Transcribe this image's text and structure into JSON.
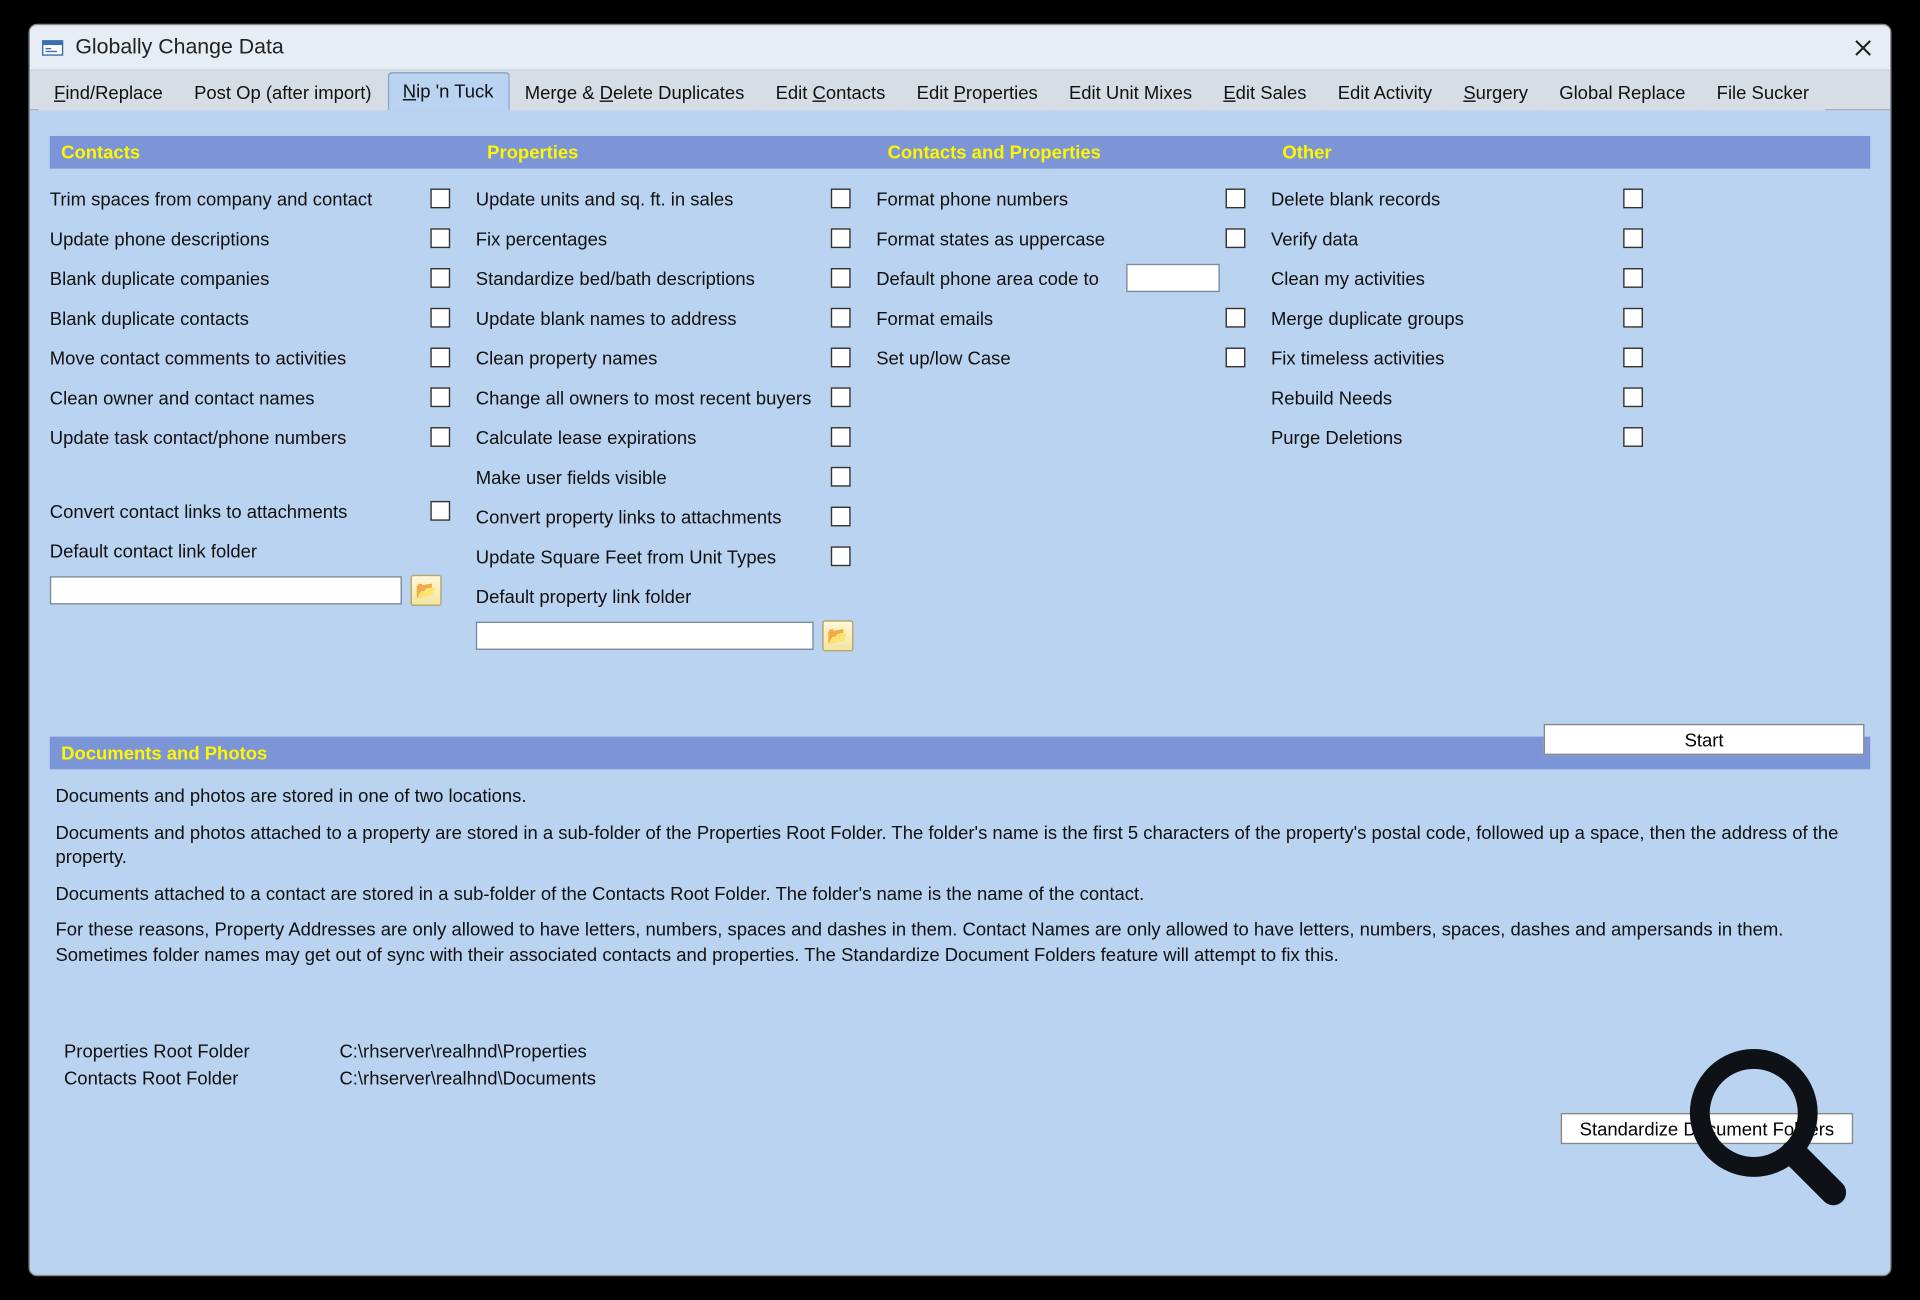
{
  "window": {
    "title": "Globally Change Data"
  },
  "tabs": [
    {
      "html": "<span class='ul'>F</span>ind/Replace"
    },
    {
      "html": "Post Op (after import)"
    },
    {
      "html": "<span class='ul'>N</span>ip 'n Tuck",
      "active": true
    },
    {
      "html": "Merge & <span class='ul'>D</span>elete Duplicates"
    },
    {
      "html": "Edit <span class='ul'>C</span>ontacts"
    },
    {
      "html": "Edit <span class='ul'>P</span>roperties"
    },
    {
      "html": "Edit Unit Mixes"
    },
    {
      "html": "<span class='ul'>E</span>dit Sales"
    },
    {
      "html": "Edit Activity"
    },
    {
      "html": "<span class='ul'>S</span>urgery"
    },
    {
      "html": "Global Replace"
    },
    {
      "html": "File Sucker"
    }
  ],
  "headers": {
    "contacts": "Contacts",
    "properties": "Properties",
    "both": "Contacts and Properties",
    "other": "Other"
  },
  "contacts_items": [
    "Trim spaces from company and contact",
    "Update phone descriptions",
    "Blank duplicate companies",
    "Blank duplicate contacts",
    "Move contact comments to activities",
    "Clean owner and contact names",
    "Update task contact/phone numbers"
  ],
  "contacts_convert": "Convert contact links to attachments",
  "contacts_default_folder_label": "Default contact link folder",
  "contacts_default_folder_value": "",
  "properties_items": [
    "Update units and sq. ft. in sales",
    "Fix percentages",
    "Standardize bed/bath descriptions",
    "Update blank names to address",
    "Clean property names",
    "Change all owners to most recent buyers",
    "Calculate lease expirations",
    "Make user fields visible",
    "Convert property links to attachments",
    "Update Square Feet from Unit Types"
  ],
  "properties_default_folder_label": "Default property link folder",
  "properties_default_folder_value": "",
  "both_items": [
    "Format phone numbers",
    "Format states as uppercase"
  ],
  "both_areacode_label": "Default phone area code to",
  "both_areacode_value": "",
  "both_items2": [
    "Format emails",
    "Set up/low Case"
  ],
  "other_items": [
    "Delete blank records",
    "Verify data",
    "Clean my activities",
    "Merge duplicate groups",
    "Fix timeless activities",
    "Rebuild Needs",
    "Purge Deletions"
  ],
  "start_label": "Start",
  "docs_header": "Documents and Photos",
  "docs_p1": "Documents and photos are stored in one of two locations.",
  "docs_p2": "Documents and photos attached to a property are stored in a sub-folder of the Properties Root Folder.  The folder's name is the first 5 characters of the property's postal code, followed up a space, then the address of the property.",
  "docs_p3": "Documents attached to a contact are stored in a sub-folder of the Contacts Root Folder.  The folder's name is the name of the contact.",
  "docs_p4": "For these reasons, Property Addresses are only allowed to have letters, numbers, spaces and dashes in them.  Contact Names are only allowed to have letters, numbers, spaces, dashes and ampersands in them.  Sometimes folder names may get out of sync with their associated contacts and properties.  The Standardize Document Folders feature will attempt to fix this.",
  "roots": {
    "prop_k": "Properties Root Folder",
    "prop_v": "C:\\rhserver\\realhnd\\Properties",
    "cont_k": "Contacts Root Folder",
    "cont_v": "C:\\rhserver\\realhnd\\Documents"
  },
  "standardize_label": "Standardize Document Folders"
}
